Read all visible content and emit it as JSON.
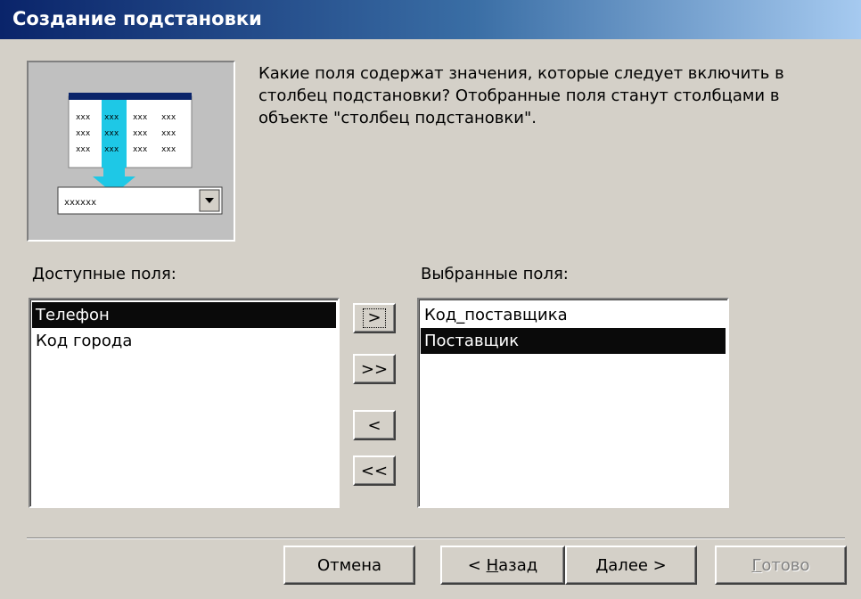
{
  "window": {
    "title": "Создание подстановки"
  },
  "instructions": "Какие поля содержат значения, которые следует включить в столбец подстановки? Отобранные поля станут столбцами в объекте \"столбец подстановки\".",
  "illustration": {
    "grid_cell": "xxx",
    "combo_value": "xxxxxx"
  },
  "available": {
    "label": "Доступные поля:",
    "items": [
      "Телефон",
      "Код города"
    ],
    "selected_index": 0
  },
  "selected": {
    "label": "Выбранные поля:",
    "items": [
      "Код_поставщика",
      "Поставщик"
    ],
    "selected_index": 1
  },
  "move_buttons": {
    "move_one": ">",
    "move_all": ">>",
    "remove_one": "<",
    "remove_all": "<<"
  },
  "footer": {
    "cancel": "Отмена",
    "back_prefix": "< ",
    "back_accel": "Н",
    "back_rest": "азад",
    "next_accel": "Д",
    "next_rest": "алее >",
    "finish_accel": "Г",
    "finish_rest": "отово"
  },
  "colors": {
    "titlebar_start": "#0a246a",
    "titlebar_end": "#a6caf0",
    "selection": "#0a0a0a",
    "arrow": "#1ec8e6"
  }
}
